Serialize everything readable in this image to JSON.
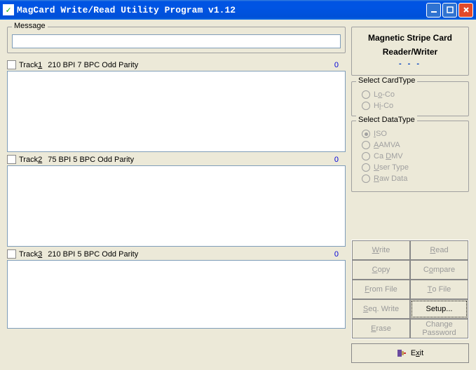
{
  "window": {
    "title": "MagCard Write/Read Utility Program v1.12"
  },
  "message": {
    "label": "Message"
  },
  "tracks": [
    {
      "name": "Track1",
      "specs": "210 BPI  7 BPC  Odd Parity",
      "count": "0",
      "ul_char": "1"
    },
    {
      "name": "Track2",
      "specs": "75 BPI  5 BPC  Odd Parity",
      "count": "0",
      "ul_char": "2"
    },
    {
      "name": "Track3",
      "specs": "210 BPI  5 BPC  Odd Parity",
      "count": "0",
      "ul_char": "3"
    }
  ],
  "rightHeader": {
    "line1": "Magnetic Stripe Card",
    "line2": "Reader/Writer",
    "dash": "- - -"
  },
  "cardType": {
    "label": "Select CardType",
    "options": [
      {
        "pre": "L",
        "ul": "o",
        "post": "-Co"
      },
      {
        "pre": "H",
        "ul": "i",
        "post": "-Co"
      }
    ]
  },
  "dataType": {
    "label": "Select DataType",
    "options": [
      {
        "pre": "",
        "ul": "I",
        "post": "SO",
        "selected": true
      },
      {
        "pre": "",
        "ul": "A",
        "post": "AMVA"
      },
      {
        "pre": "Ca ",
        "ul": "D",
        "post": "MV"
      },
      {
        "pre": "",
        "ul": "U",
        "post": "ser Type"
      },
      {
        "pre": "",
        "ul": "R",
        "post": "aw Data"
      }
    ]
  },
  "buttons": {
    "write": "Write",
    "read": "Read",
    "copy": "Copy",
    "compare": "Compare",
    "fromfile": "From File",
    "tofile": "To File",
    "seqwrite": "Seq. Write",
    "setup": "Setup...",
    "erase": "Erase",
    "changepw_l1": "Change",
    "changepw_l2": "Password",
    "exit": "Exit"
  }
}
